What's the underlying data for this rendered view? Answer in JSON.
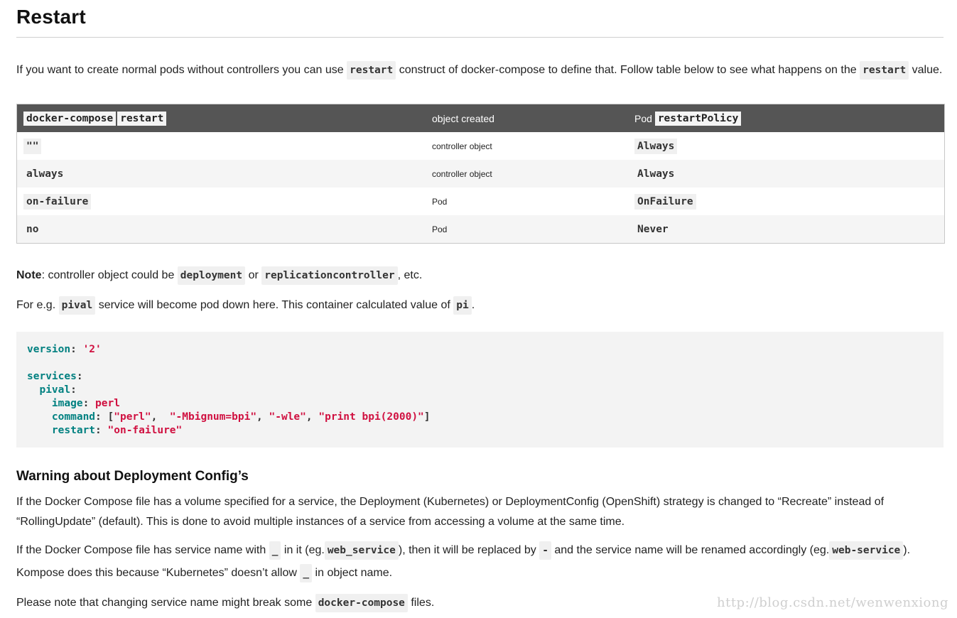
{
  "title": "Restart",
  "intro": {
    "t1": "If you want to create normal pods without controllers you can use",
    "c1": "restart",
    "t2": "construct of docker-compose to define that. Follow table below to see what happens on the",
    "c2": "restart",
    "t3": "value."
  },
  "table": {
    "header": {
      "col1_code1": "docker-compose",
      "col1_code2": "restart",
      "col2": "object created",
      "col3_text": "Pod",
      "col3_code": "restartPolicy"
    },
    "rows": [
      {
        "restart": "\"\"",
        "object": "controller object",
        "policy": "Always"
      },
      {
        "restart": "always",
        "object": "controller object",
        "policy": "Always"
      },
      {
        "restart": "on-failure",
        "object": "Pod",
        "policy": "OnFailure"
      },
      {
        "restart": "no",
        "object": "Pod",
        "policy": "Never"
      }
    ]
  },
  "note": {
    "label": "Note",
    "t1": ": controller object could be",
    "c1": "deployment",
    "t2": "or",
    "c2": "replicationcontroller",
    "t3": ", etc."
  },
  "example": {
    "t1": "For e.g.",
    "c1": "pival",
    "t2": "service will become pod down here. This container calculated value of",
    "c2": "pi",
    "t3": "."
  },
  "code_block": {
    "version_key": "version",
    "version_val": "'2'",
    "services_key": "services",
    "service_name": "pival",
    "image_key": "image",
    "image_val": "perl",
    "command_key": "command",
    "command_args": [
      "\"perl\"",
      "\"-Mbignum=bpi\"",
      "\"-wle\"",
      "\"print bpi(2000)\""
    ],
    "restart_key": "restart",
    "restart_val": "\"on-failure\""
  },
  "warning": {
    "heading": "Warning about Deployment Config’s",
    "para1": "If the Docker Compose file has a volume specified for a service, the Deployment (Kubernetes) or DeploymentConfig (OpenShift) strategy is changed to “Recreate” instead of “RollingUpdate” (default). This is done to avoid multiple instances of a service from accessing a volume at the same time.",
    "p2_t1": "If the Docker Compose file has service name with",
    "p2_c1": "_",
    "p2_t2": "in it (eg.",
    "p2_c2": "web_service",
    "p2_t3": "), then it will be replaced by",
    "p2_c3": "-",
    "p2_t4": "and the service name will be renamed accordingly (eg.",
    "p2_c4": "web-service",
    "p2_t5": ").",
    "p3_t1": "Kompose does this because “Kubernetes” doesn’t allow",
    "p3_c1": "_",
    "p3_t2": "in object name.",
    "p4_t1": "Please note that changing service name might break some",
    "p4_c1": "docker-compose",
    "p4_t2": "files."
  },
  "watermark": "http://blog.csdn.net/wenwenxiong"
}
